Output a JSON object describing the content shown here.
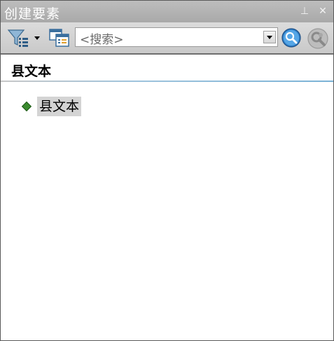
{
  "window": {
    "title": "创建要素",
    "pin_glyph": "⊥",
    "close_glyph": "✕"
  },
  "toolbar": {
    "search_placeholder": "<搜索>",
    "icons": [
      "filter-icon",
      "dropdown-arrow-icon",
      "organize-templates-icon",
      "search-icon",
      "find-icon"
    ]
  },
  "layer": {
    "name": "县文本"
  },
  "templates": [
    {
      "label": "县文本",
      "icon": "point-symbol-icon",
      "symbol_color": "#3a8a2e",
      "selected": true
    }
  ]
}
